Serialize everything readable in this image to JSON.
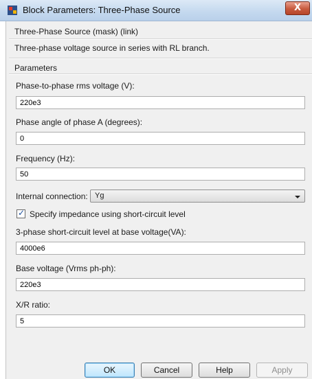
{
  "window": {
    "title": "Block Parameters: Three-Phase Source",
    "close_glyph": "X",
    "icon": "simulink-block-icon"
  },
  "header": {
    "block_name": "Three-Phase Source (mask) (link)",
    "description": "Three-phase voltage source in series with RL branch."
  },
  "parameters": {
    "heading": "Parameters",
    "voltage": {
      "label": "Phase-to-phase rms voltage (V):",
      "value": "220e3"
    },
    "phase_angle": {
      "label": "Phase angle of phase A (degrees):",
      "value": "0"
    },
    "frequency": {
      "label": "Frequency (Hz):",
      "value": "50"
    },
    "internal_connection": {
      "label": "Internal connection:",
      "value": "Yg"
    },
    "specify_impedance": {
      "label": "Specify impedance using short-circuit level",
      "checked": true,
      "mark": "✓"
    },
    "short_circuit_level": {
      "label": "3-phase short-circuit level at base voltage(VA):",
      "value": "4000e6"
    },
    "base_voltage": {
      "label": "Base voltage (Vrms ph-ph):",
      "value": "220e3"
    },
    "xr_ratio": {
      "label": "X/R ratio:",
      "value": "5"
    }
  },
  "buttons": {
    "ok": "OK",
    "cancel": "Cancel",
    "help": "Help",
    "apply": "Apply"
  }
}
